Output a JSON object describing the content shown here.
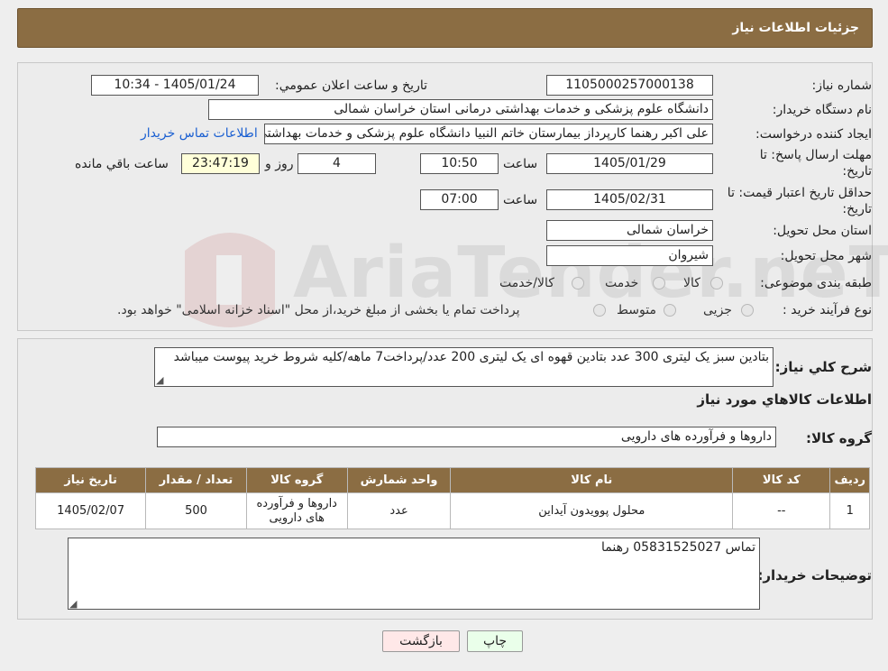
{
  "header": {
    "title": "جزئیات اطلاعات نیاز"
  },
  "need_number": {
    "label": "شماره نیاز:",
    "value": "1105000257000138"
  },
  "announce": {
    "label": "تاريخ و ساعت اعلان عمومي:",
    "value": "1405/01/24 - 10:34"
  },
  "buyer_org": {
    "label": "نام دستگاه خريدار:",
    "value": "دانشگاه علوم پزشکی و خدمات بهداشتی درمانی استان خراسان شمالی"
  },
  "requester": {
    "label": "ایجاد کننده درخواست:",
    "value": "علی اکبر رهنما کارپرداز بیمارستان خاتم النبیا دانشگاه علوم پزشکی و خدمات بهداشتی درمانی استان خراسان شمالی",
    "contact_link": "اطلاعات تماس خريدار"
  },
  "deadline": {
    "label_line1": "مهلت ارسال پاسخ: تا",
    "label_line2": "تاریخ:",
    "date": "1405/01/29",
    "time_label": "ساعت",
    "time": "10:50",
    "days": "4",
    "days_label": "روز و",
    "remaining": "23:47:19",
    "remaining_label": "ساعت باقي مانده"
  },
  "validity": {
    "label_line1": "حداقل تاريخ اعتبار قيمت: تا",
    "label_line2": "تاريخ:",
    "date": "1405/02/31",
    "time_label": "ساعت",
    "time": "07:00"
  },
  "province": {
    "label": "استان محل تحویل:",
    "value": "خراسان شمالی"
  },
  "city": {
    "label": "شهر محل تحویل:",
    "value": "شیروان"
  },
  "category": {
    "label": "طبقه بندی موضوعی:",
    "options": [
      "کالا",
      "خدمت",
      "کالا/خدمت"
    ]
  },
  "process": {
    "label": "نوع فرآيند خريد :",
    "options": [
      "جزیی",
      "متوسط"
    ],
    "note": "پرداخت تمام یا بخشی از مبلغ خرید،از محل \"اسناد خزانه اسلامی\" خواهد بود."
  },
  "description": {
    "label": "شرح کلي نياز:",
    "value": "بتادین سبز یک لیتری 300 عدد بتادین قهوه ای یک لیتری 200 عدد/پرداخت7 ماهه/کلیه شروط خرید پیوست میباشد"
  },
  "items_section": {
    "title": "اطلاعات کالاهاي مورد نياز"
  },
  "goods_group": {
    "label": "گروه کالا:",
    "value": "داروها و فرآورده های دارویی"
  },
  "table": {
    "headers": [
      "رديف",
      "کد کالا",
      "نام کالا",
      "واحد شمارش",
      "گروه کالا",
      "تعداد / مقدار",
      "تاريخ نياز"
    ],
    "rows": [
      [
        "1",
        "--",
        "محلول پوویدون آیداین",
        "عدد",
        "داروها و فرآورده های دارویی",
        "500",
        "1405/02/07"
      ]
    ]
  },
  "buyer_notes": {
    "label": "توضيحات خريدار:",
    "value": "تماس 05831525027 رهنما"
  },
  "buttons": {
    "print": "چاپ",
    "back": "بازگشت"
  },
  "watermark": {
    "text": "AriaTender.neT"
  },
  "colors": {
    "header_bg": "#8b6d43",
    "link": "#1a5fd1",
    "remaining_bg": "#ffffd9",
    "print_btn_bg": "#eaffea",
    "back_btn_bg": "#ffe8e8"
  }
}
